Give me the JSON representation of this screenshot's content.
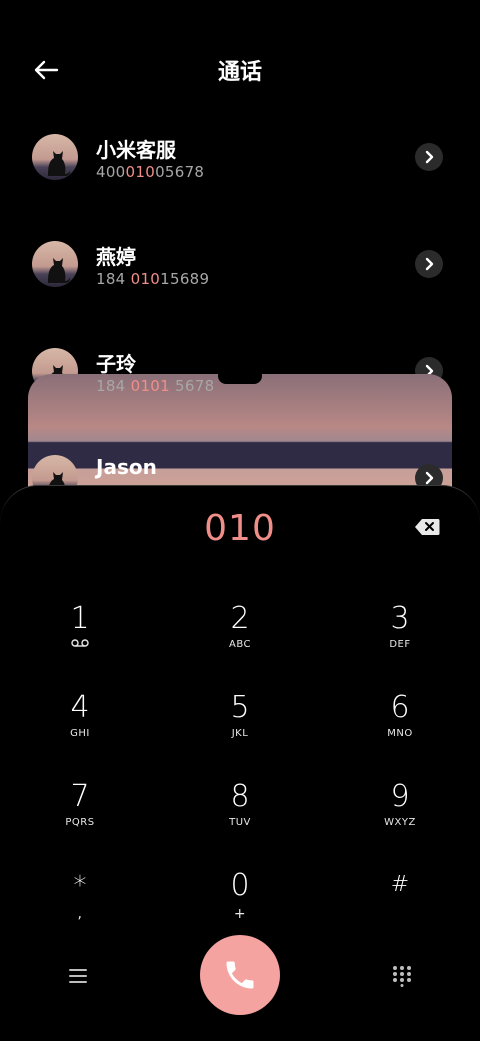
{
  "header": {
    "title": "通话",
    "back_icon": "back-arrow-icon"
  },
  "contacts": [
    {
      "name": "小米客服",
      "number_pre": "400",
      "number_hl": "010",
      "number_post": "05678"
    },
    {
      "name": "燕婷",
      "number_pre": "184 ",
      "number_hl": "010",
      "number_post": "15689"
    },
    {
      "name": "子玲",
      "number_pre": "184 ",
      "number_hl": "0101",
      "number_post": " 5678"
    },
    {
      "name": "Jason",
      "number_pre": "",
      "number_hl": "",
      "number_post": ""
    }
  ],
  "dialpad": {
    "display": "010",
    "keys": [
      {
        "digit": "1",
        "letters": "voicemail-icon"
      },
      {
        "digit": "2",
        "letters": "ABC"
      },
      {
        "digit": "3",
        "letters": "DEF"
      },
      {
        "digit": "4",
        "letters": "GHI"
      },
      {
        "digit": "5",
        "letters": "JKL"
      },
      {
        "digit": "6",
        "letters": "MNO"
      },
      {
        "digit": "7",
        "letters": "PQRS"
      },
      {
        "digit": "8",
        "letters": "TUV"
      },
      {
        "digit": "9",
        "letters": "WXYZ"
      },
      {
        "digit": "*",
        "letters": ","
      },
      {
        "digit": "0",
        "letters": "+"
      },
      {
        "digit": "#",
        "letters": ""
      }
    ]
  },
  "colors": {
    "accent": "#f08e8a",
    "call_button": "#f4a3a0",
    "background": "#000000"
  }
}
